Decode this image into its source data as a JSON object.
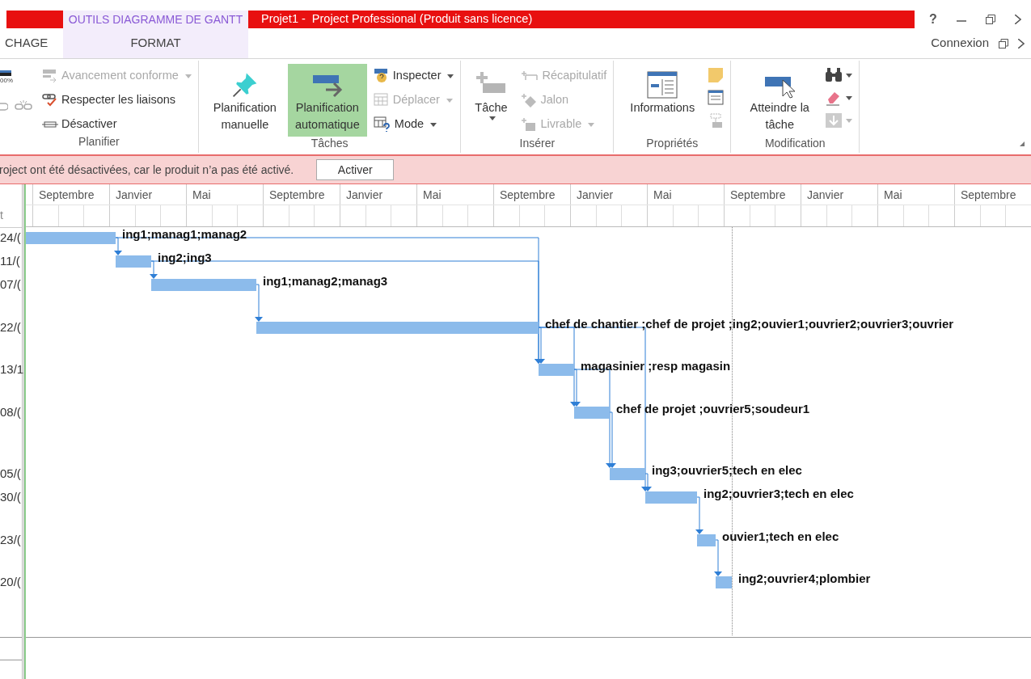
{
  "title_bar": {
    "context_tab": "OUTILS DIAGRAMME DE GANTT",
    "title": "Projet1 -  Project Professional (Produit sans licence)",
    "help": "?"
  },
  "ribbon_tabs": [
    {
      "label": "CHAGE",
      "selected": false
    },
    {
      "label": "FORMAT",
      "selected": true
    }
  ],
  "account": {
    "label": "Connexion"
  },
  "ribbon_groups": [
    {
      "label": "Planifier",
      "items": [
        {
          "kind": "percent",
          "label": "00%"
        },
        {
          "kind": "small",
          "label": "Avancement conforme",
          "disabled": true,
          "dropdown": true
        },
        {
          "kind": "small",
          "label": "Respecter les liaisons",
          "disabled": false,
          "dropdown": false
        },
        {
          "kind": "small",
          "label": "Désactiver",
          "disabled": false,
          "dropdown": false
        }
      ]
    },
    {
      "label": "Tâches",
      "items": [
        {
          "kind": "large",
          "label": "Planification manuelle",
          "selected": false,
          "disabled": false,
          "dropdown": false
        },
        {
          "kind": "large",
          "label": "Planification automatique",
          "selected": true,
          "disabled": false,
          "dropdown": false
        },
        {
          "kind": "small",
          "label": "Inspecter",
          "disabled": false,
          "dropdown": true
        },
        {
          "kind": "small",
          "label": "Déplacer",
          "disabled": true,
          "dropdown": true
        },
        {
          "kind": "small",
          "label": "Mode",
          "disabled": false,
          "dropdown": true
        }
      ]
    },
    {
      "label": "Insérer",
      "items": [
        {
          "kind": "large",
          "label": "Tâche",
          "selected": false,
          "disabled": false,
          "dropdown": true
        },
        {
          "kind": "small",
          "label": "Récapitulatif",
          "disabled": true,
          "dropdown": false
        },
        {
          "kind": "small",
          "label": "Jalon",
          "disabled": true,
          "dropdown": false
        },
        {
          "kind": "small",
          "label": "Livrable",
          "disabled": true,
          "dropdown": true
        }
      ]
    },
    {
      "label": "Propriétés",
      "items": [
        {
          "kind": "large",
          "label": "Informations",
          "selected": false,
          "disabled": false,
          "dropdown": false
        },
        {
          "kind": "icons"
        }
      ]
    },
    {
      "label": "Modification",
      "items": [
        {
          "kind": "large",
          "label": "Atteindre la tâche",
          "selected": false,
          "disabled": false,
          "dropdown": false
        },
        {
          "kind": "icons",
          "dropdown": true
        }
      ]
    }
  ],
  "message_bar": {
    "text": "roject ont été désactivées, car le produit n’a pas été activé.",
    "button": "Activer"
  },
  "date_column": {
    "header": "t"
  },
  "timeline": {
    "months": [
      "Septembre",
      "Janvier",
      "Mai",
      "Septembre",
      "Janvier",
      "Mai",
      "Septembre",
      "Janvier",
      "Mai",
      "Septembre",
      "Janvier",
      "Mai",
      "Septembre"
    ]
  },
  "tasks": [
    {
      "date": "24/(",
      "resources": "ing1;manag1;manag2"
    },
    {
      "date": "11/(",
      "resources": "ing2;ing3"
    },
    {
      "date": "07/(",
      "resources": "ing1;manag2;manag3"
    },
    {
      "date": "22/(",
      "resources": "chef de chantier ;chef de projet ;ing2;ouvier1;ouvrier2;ouvrier3;ouvrier"
    },
    {
      "date": "13/1",
      "resources": "magasinier ;resp magasin"
    },
    {
      "date": "08/(",
      "resources": "chef de projet ;ouvrier5;soudeur1"
    },
    {
      "date": "05/(",
      "resources": "ing3;ouvrier5;tech en elec"
    },
    {
      "date": "30/(",
      "resources": "ing2;ouvrier3;tech en elec"
    },
    {
      "date": "23/(",
      "resources": "ouvier1;tech en elec"
    },
    {
      "date": "20/(",
      "resources": "ing2;ouvrier4;plombier"
    }
  ]
}
